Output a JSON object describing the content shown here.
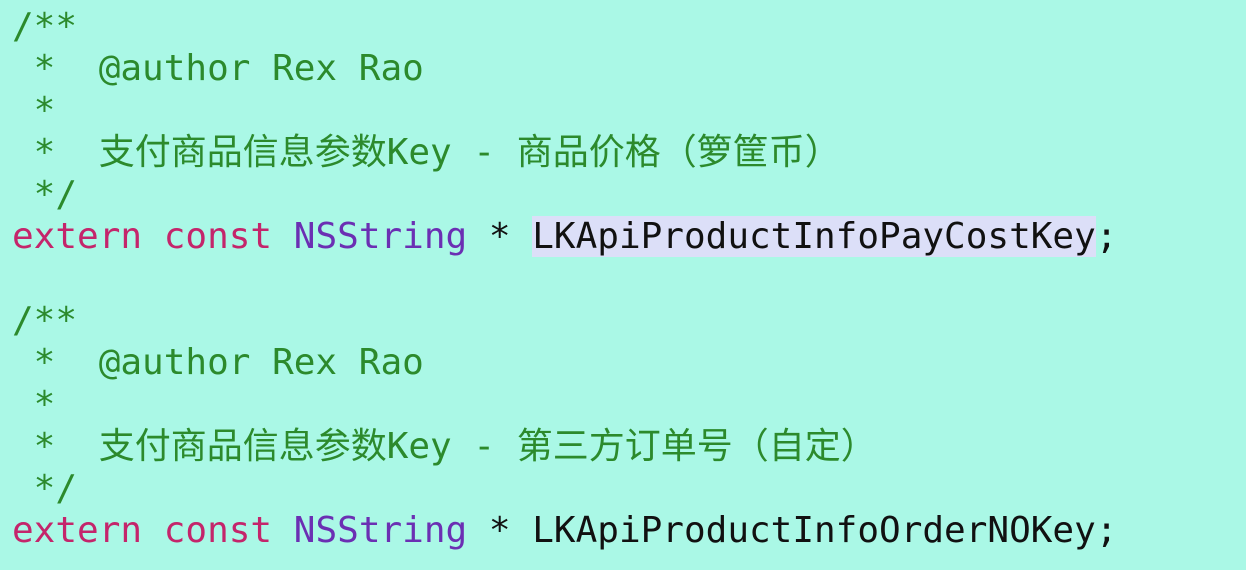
{
  "colors": {
    "background": "#aaf8e6",
    "comment": "#2c8a2c",
    "keyword": "#c4256b",
    "type": "#6b2fb3",
    "text": "#111111",
    "selection": "#dcdff8"
  },
  "blocks": [
    {
      "comment_open": "/**",
      "author": " *  @author Rex Rao",
      "blank": " *",
      "desc": " *  支付商品信息参数Key - 商品价格（箩筐币）",
      "comment_close": " */",
      "kw_extern": "extern",
      "kw_const": "const",
      "type": "NSString",
      "star": "*",
      "identifier": "LKApiProductInfoPayCostKey",
      "semicolon": ";"
    },
    {
      "comment_open": "/**",
      "author": " *  @author Rex Rao",
      "blank": " *",
      "desc": " *  支付商品信息参数Key - 第三方订单号（自定）",
      "comment_close": " */",
      "kw_extern": "extern",
      "kw_const": "const",
      "type": "NSString",
      "star": "*",
      "identifier": "LKApiProductInfoOrderNOKey",
      "semicolon": ";"
    }
  ]
}
